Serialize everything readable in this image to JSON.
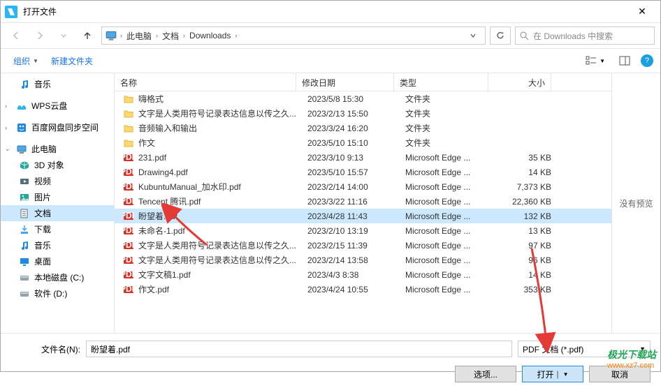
{
  "window": {
    "title": "打开文件"
  },
  "breadcrumb": {
    "root_icon": "pc",
    "segs": [
      "此电脑",
      "文档",
      "Downloads"
    ]
  },
  "search": {
    "placeholder": "在 Downloads 中搜索"
  },
  "toolbar": {
    "organize": "组织",
    "new_folder": "新建文件夹"
  },
  "sidebar": [
    {
      "icon": "music",
      "label": "音乐",
      "indent": 1,
      "color": "#1e88e5"
    },
    {
      "icon": "wps",
      "label": "WPS云盘",
      "indent": 0,
      "color": "#29b6f6",
      "spacer_before": true
    },
    {
      "icon": "baidu",
      "label": "百度网盘同步空间",
      "indent": 0,
      "color": "#1e88e5",
      "spacer_before": true
    },
    {
      "icon": "pc",
      "label": "此电脑",
      "indent": 0,
      "color": "#1e88e5",
      "expanded": true,
      "spacer_before": true
    },
    {
      "icon": "cube",
      "label": "3D 对象",
      "indent": 1,
      "color": "#26a69a"
    },
    {
      "icon": "video",
      "label": "视频",
      "indent": 1,
      "color": "#546e7a"
    },
    {
      "icon": "pictures",
      "label": "图片",
      "indent": 1,
      "color": "#26a69a"
    },
    {
      "icon": "docs",
      "label": "文档",
      "indent": 1,
      "color": "#546e7a",
      "selected": true
    },
    {
      "icon": "download",
      "label": "下载",
      "indent": 1,
      "color": "#42a5f5"
    },
    {
      "icon": "music",
      "label": "音乐",
      "indent": 1,
      "color": "#1e88e5"
    },
    {
      "icon": "desktop",
      "label": "桌面",
      "indent": 1,
      "color": "#1e88e5"
    },
    {
      "icon": "disk",
      "label": "本地磁盘 (C:)",
      "indent": 1,
      "color": "#90a4ae"
    },
    {
      "icon": "disk",
      "label": "软件 (D:)",
      "indent": 1,
      "color": "#90a4ae"
    }
  ],
  "columns": {
    "name": "名称",
    "date": "修改日期",
    "type": "类型",
    "size": "大小"
  },
  "files": [
    {
      "icon": "folder",
      "name": "嗨格式",
      "date": "2023/5/8 15:30",
      "type": "文件夹",
      "size": ""
    },
    {
      "icon": "folder",
      "name": "文字是人类用符号记录表达信息以传之久...",
      "date": "2023/2/13 15:50",
      "type": "文件夹",
      "size": ""
    },
    {
      "icon": "folder",
      "name": "音频输入和输出",
      "date": "2023/3/24 16:20",
      "type": "文件夹",
      "size": ""
    },
    {
      "icon": "folder",
      "name": "作文",
      "date": "2023/5/10 15:10",
      "type": "文件夹",
      "size": ""
    },
    {
      "icon": "pdf",
      "name": "231.pdf",
      "date": "2023/3/10 9:13",
      "type": "Microsoft Edge ...",
      "size": "35 KB"
    },
    {
      "icon": "pdf",
      "name": "Drawing4.pdf",
      "date": "2023/5/10 15:57",
      "type": "Microsoft Edge ...",
      "size": "14 KB"
    },
    {
      "icon": "pdf",
      "name": "KubuntuManual_加水印.pdf",
      "date": "2023/2/14 14:00",
      "type": "Microsoft Edge ...",
      "size": "7,373 KB"
    },
    {
      "icon": "pdf",
      "name": "Tencent 腾讯.pdf",
      "date": "2023/3/22 11:16",
      "type": "Microsoft Edge ...",
      "size": "22,360 KB"
    },
    {
      "icon": "pdf",
      "name": "盼望着.pdf",
      "date": "2023/4/28 11:43",
      "type": "Microsoft Edge ...",
      "size": "132 KB",
      "selected": true
    },
    {
      "icon": "pdf",
      "name": "未命名-1.pdf",
      "date": "2023/2/10 13:19",
      "type": "Microsoft Edge ...",
      "size": "13 KB"
    },
    {
      "icon": "pdf",
      "name": "文字是人类用符号记录表达信息以传之久...",
      "date": "2023/2/15 11:39",
      "type": "Microsoft Edge ...",
      "size": "97 KB"
    },
    {
      "icon": "pdf",
      "name": "文字是人类用符号记录表达信息以传之久...",
      "date": "2023/2/14 13:58",
      "type": "Microsoft Edge ...",
      "size": "96 KB"
    },
    {
      "icon": "pdf",
      "name": "文字文稿1.pdf",
      "date": "2023/4/3 8:38",
      "type": "Microsoft Edge ...",
      "size": "14 KB"
    },
    {
      "icon": "pdf",
      "name": "作文.pdf",
      "date": "2023/4/24 10:55",
      "type": "Microsoft Edge ...",
      "size": "353 KB"
    }
  ],
  "preview": {
    "label": "没有预览"
  },
  "bottom": {
    "filename_label": "文件名(N):",
    "filename_value": "盼望着.pdf",
    "filter": "PDF 文档 (*.pdf)",
    "options": "选项...",
    "open": "打开",
    "cancel": "取消"
  },
  "watermark": {
    "line1": "极光下载站",
    "line2": "www.xz7.com"
  }
}
